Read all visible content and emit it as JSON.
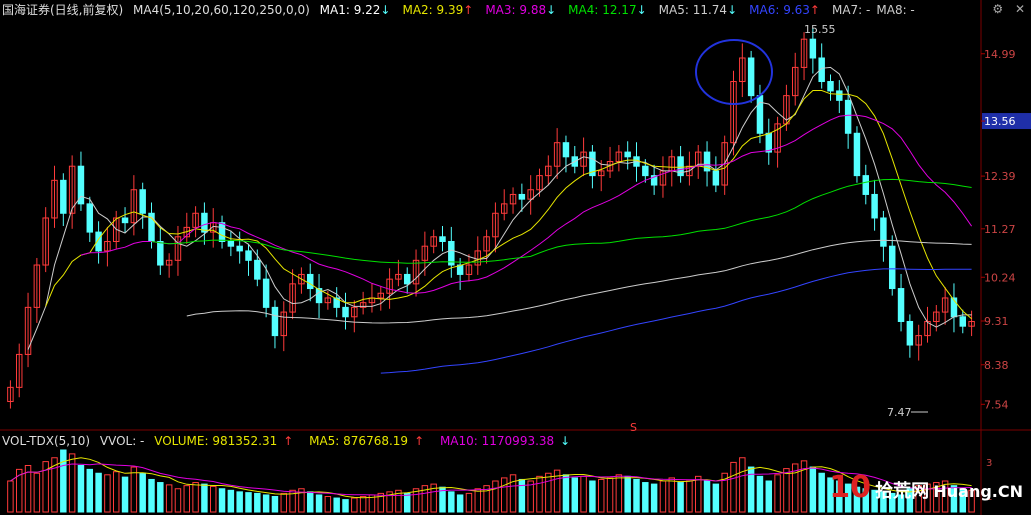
{
  "header": {
    "stock": "国海证券(日线,前复权)",
    "ma_set": "MA4(5,10,20,60,120,250,0,0)",
    "ma": [
      {
        "label": "MA1: 9.22",
        "arrow": "↓",
        "color": "#ffffff"
      },
      {
        "label": "MA2: 9.39",
        "arrow": "↑",
        "color": "#e6e600"
      },
      {
        "label": "MA3: 9.88",
        "arrow": "↓",
        "color": "#e000e0"
      },
      {
        "label": "MA4: 12.17",
        "arrow": "↓",
        "color": "#00e000"
      },
      {
        "label": "MA5: 11.74",
        "arrow": "↓",
        "color": "#cccccc"
      },
      {
        "label": "MA6: 9.63",
        "arrow": "↑",
        "color": "#3344ff"
      },
      {
        "label": "MA7: -",
        "arrow": "",
        "color": "#cccccc"
      },
      {
        "label": "MA8: -",
        "arrow": "",
        "color": "#cccccc"
      }
    ],
    "icons": [
      "gear-icon",
      "close-icon"
    ]
  },
  "volume_header": {
    "title": "VOL-TDX(5,10)",
    "vvol": "VVOL: -",
    "volume": "VOLUME: 981352.31",
    "volume_arrow": "↑",
    "ma5": "MA5: 876768.19",
    "ma5_arrow": "↑",
    "ma10": "MA10: 1170993.38",
    "ma10_arrow": "↓"
  },
  "watermark": {
    "num": "10",
    "cn": "拾荒网",
    "en": "Huang.CN"
  },
  "chart_data": {
    "type": "candlestick",
    "price_axis": {
      "ticks": [
        14.99,
        13.56,
        12.39,
        11.27,
        10.24,
        9.31,
        8.38,
        7.54
      ],
      "current": 13.56,
      "ylim": [
        7.1,
        15.75
      ]
    },
    "annotations": {
      "high": "15.55",
      "low": "7.47",
      "marker": "S"
    },
    "volume_axis": {
      "ticks": [
        "1",
        "3"
      ]
    },
    "colors": {
      "up": "#ff3b3b",
      "down": "#54ffff",
      "ma_yellow": "#e6e600",
      "ma_magenta": "#e000e0",
      "ma_green": "#00e000",
      "ma_white": "#cccccc",
      "ma_blue": "#3344ff",
      "circle": "#2233dd"
    },
    "close_series": [
      7.9,
      8.6,
      9.6,
      10.5,
      11.5,
      12.3,
      11.6,
      12.6,
      11.8,
      11.2,
      10.8,
      11.0,
      11.5,
      11.4,
      12.1,
      11.6,
      11.0,
      10.5,
      10.6,
      11.1,
      11.3,
      11.6,
      11.2,
      11.4,
      11.0,
      10.9,
      10.8,
      10.6,
      10.2,
      9.6,
      9.0,
      9.5,
      10.1,
      10.3,
      10.0,
      9.7,
      9.8,
      9.6,
      9.4,
      9.6,
      9.7,
      9.8,
      9.9,
      10.2,
      10.3,
      10.1,
      10.6,
      10.9,
      11.1,
      11.0,
      10.5,
      10.3,
      10.5,
      10.8,
      11.1,
      11.6,
      11.8,
      12.0,
      11.9,
      12.1,
      12.4,
      12.6,
      13.1,
      12.8,
      12.6,
      12.9,
      12.4,
      12.5,
      12.7,
      12.9,
      12.8,
      12.6,
      12.4,
      12.2,
      12.5,
      12.8,
      12.4,
      12.6,
      12.9,
      12.5,
      12.2,
      13.1,
      14.4,
      14.9,
      14.1,
      13.3,
      12.9,
      13.5,
      14.1,
      14.7,
      15.3,
      14.9,
      14.4,
      14.2,
      14.0,
      13.3,
      12.4,
      12.0,
      11.5,
      10.9,
      10.0,
      9.3,
      8.8,
      9.0,
      9.3,
      9.5,
      9.8,
      9.4,
      9.2,
      9.3
    ],
    "volume_series": [
      40,
      55,
      60,
      50,
      65,
      70,
      80,
      75,
      60,
      55,
      50,
      48,
      52,
      45,
      58,
      50,
      42,
      38,
      35,
      30,
      34,
      38,
      36,
      33,
      30,
      28,
      26,
      25,
      24,
      22,
      20,
      24,
      28,
      30,
      26,
      22,
      20,
      18,
      16,
      18,
      20,
      22,
      24,
      26,
      28,
      24,
      30,
      34,
      36,
      32,
      26,
      22,
      24,
      30,
      34,
      40,
      44,
      48,
      42,
      40,
      46,
      50,
      54,
      48,
      44,
      46,
      40,
      42,
      44,
      48,
      46,
      42,
      38,
      36,
      40,
      44,
      38,
      40,
      46,
      40,
      36,
      50,
      64,
      70,
      58,
      46,
      40,
      48,
      56,
      62,
      66,
      58,
      50,
      44,
      40,
      36,
      32,
      30,
      28,
      26,
      24,
      22,
      30,
      34,
      36,
      38,
      40,
      34,
      30,
      28
    ]
  }
}
